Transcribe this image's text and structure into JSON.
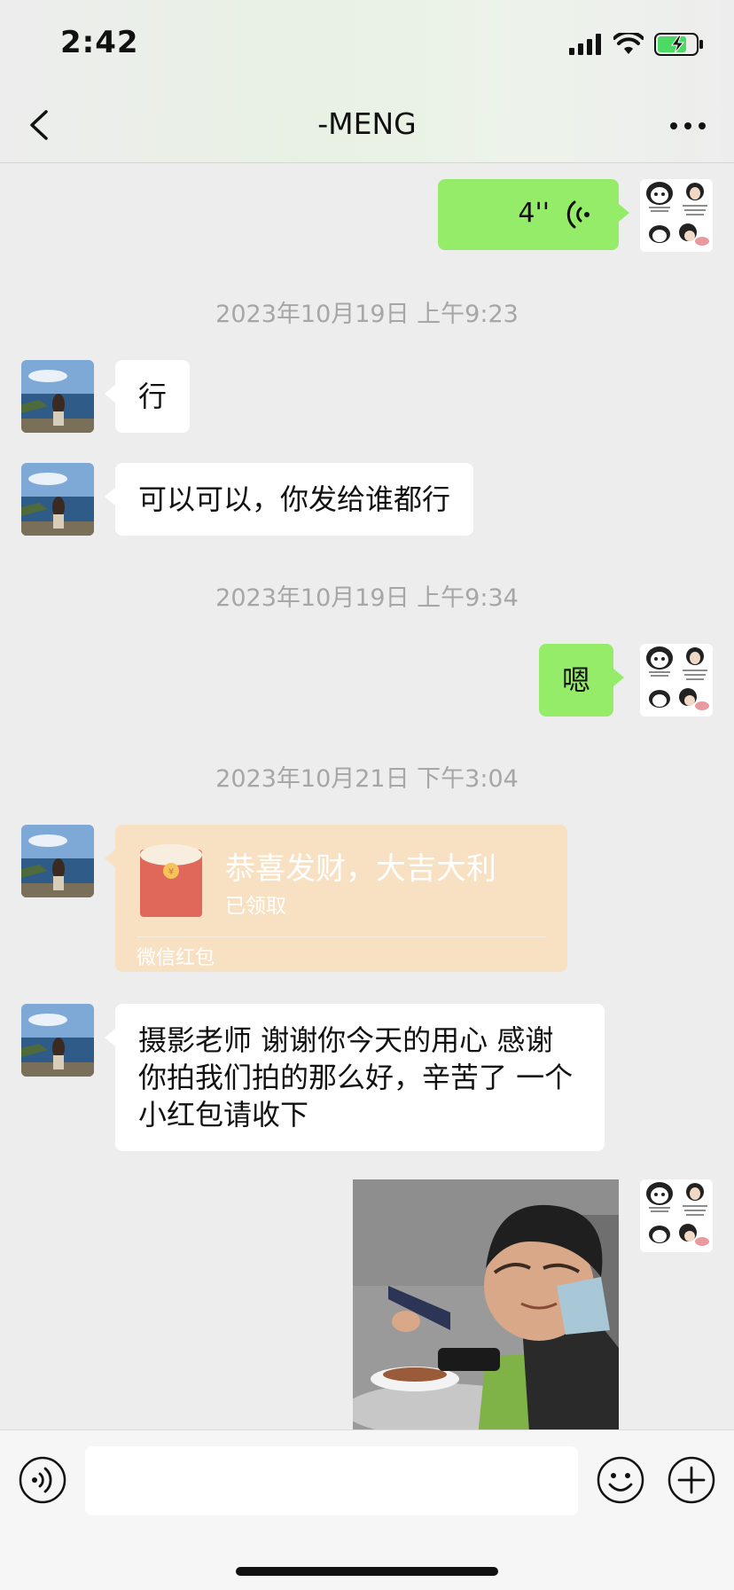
{
  "status_bar": {
    "time": "2:42"
  },
  "nav": {
    "title": "-MENG",
    "back_icon": "chevron-left-icon",
    "more_icon": "ellipsis-icon"
  },
  "messages": {
    "voice": {
      "duration": "4''"
    },
    "ts1": "2023年10月19日 上午9:23",
    "msg1": "行",
    "msg2": "可以可以，你发给谁都行",
    "ts2": "2023年10月19日 上午9:34",
    "msg3": "嗯",
    "ts3": "2023年10月21日 下午3:04",
    "red_packet": {
      "title": "恭喜发财，大吉大利",
      "status": "已领取",
      "footer": "微信红包"
    },
    "msg4": "摄影老师 谢谢你今天的用心 感谢你拍我们拍的那么好，辛苦了 一个小红包请收下"
  },
  "input_bar": {
    "text": "",
    "voice_icon": "voice-icon",
    "emoji_icon": "emoji-icon",
    "plus_icon": "plus-icon"
  },
  "colors": {
    "background": "#ededed",
    "sent_bubble": "#95ec69",
    "received_bubble": "#ffffff",
    "red_packet_bg": "#f8e1c3",
    "timestamp": "#a6a6a6"
  }
}
